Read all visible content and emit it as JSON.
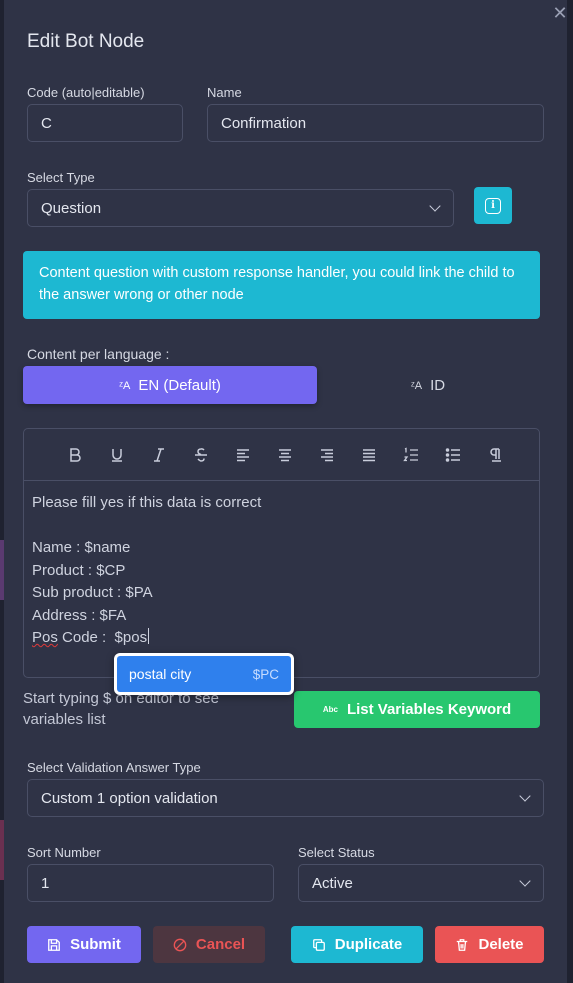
{
  "modal": {
    "title": "Edit Bot Node",
    "close_glyph": "✕"
  },
  "code": {
    "label": "Code (auto|editable)",
    "value": "C"
  },
  "name": {
    "label": "Name",
    "value": "Confirmation"
  },
  "type": {
    "label": "Select Type",
    "value": "Question"
  },
  "alert": {
    "text": "Content question with custom response handler, you could link the child to the answer wrong or other node"
  },
  "language": {
    "label": "Content per language :",
    "tabs": [
      {
        "label": "EN (Default)",
        "active": true
      },
      {
        "label": "ID",
        "active": false
      }
    ]
  },
  "editor": {
    "toolbar": [
      "bold-icon",
      "underline-icon",
      "italic-icon",
      "strikethrough-icon",
      "align-left-icon",
      "align-center-icon",
      "align-right-icon",
      "align-justify-icon",
      "ordered-list-icon",
      "unordered-list-icon",
      "paragraph-icon"
    ],
    "lines": {
      "l1": "Please fill yes if this data is correct",
      "l3": "Name : $name",
      "l4": "Product : $CP",
      "l5": "Sub product : $PA",
      "l6": "Address : $FA",
      "l7_prefix": "Pos",
      "l7_rest": " Code :  $pos"
    }
  },
  "autocomplete": {
    "label": "postal city",
    "code": "$PC"
  },
  "variables": {
    "hint": "Start typing $ on editor to see variables list",
    "button": "List Variables Keyword",
    "button_badge": "Abc"
  },
  "validation": {
    "label": "Select Validation Answer Type",
    "value": "Custom 1 option validation"
  },
  "sort": {
    "label": "Sort Number",
    "value": "1"
  },
  "status": {
    "label": "Select Status",
    "value": "Active"
  },
  "actions": {
    "submit": "Submit",
    "cancel": "Cancel",
    "duplicate": "Duplicate",
    "delete": "Delete"
  },
  "colors": {
    "primary": "#7367f0",
    "info": "#1db8d2",
    "success": "#28c76f",
    "danger": "#ea5455",
    "autocomplete": "#2f80ed"
  }
}
